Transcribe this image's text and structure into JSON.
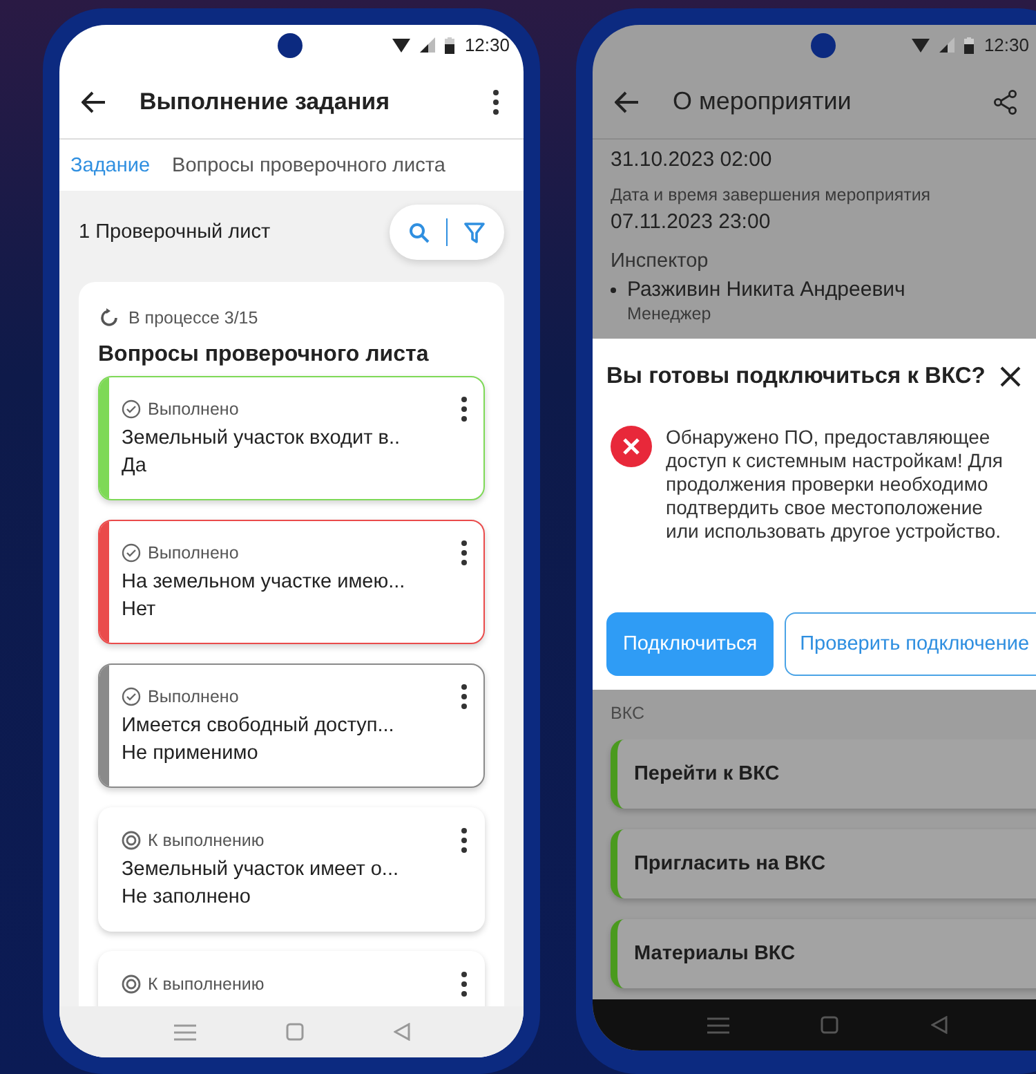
{
  "left_phone": {
    "status_bar": {
      "time": "12:30"
    },
    "app_bar": {
      "title": "Выполнение задания"
    },
    "tabs": [
      {
        "label": "Задание",
        "selected": true
      },
      {
        "label": "Вопросы проверочного листа",
        "selected": false
      }
    ],
    "checklist_count": "1 Проверочный лист",
    "checklist": {
      "progress": "В процессе 3/15",
      "title": "Вопросы проверочного листа",
      "questions": [
        {
          "kind": "done",
          "status": "Выполнено",
          "question": "Земельный участок входит в..",
          "answer": "Да",
          "color": "#7ed957"
        },
        {
          "kind": "done",
          "status": "Выполнено",
          "question": "На земельном участке имею...",
          "answer": "Нет",
          "color": "#ea4b4b"
        },
        {
          "kind": "done",
          "status": "Выполнено",
          "question": "Имеется свободный доступ...",
          "answer": "Не применимо",
          "color": "#8a8a8a"
        },
        {
          "kind": "todo",
          "status": "К выполнению",
          "question": "Земельный участок имеет о...",
          "answer": "Не заполнено"
        },
        {
          "kind": "todo",
          "status": "К выполнению"
        }
      ]
    }
  },
  "right_phone": {
    "status_bar": {
      "time": "12:30"
    },
    "app_bar": {
      "title": "О мероприятии"
    },
    "details": [
      {
        "kind": "value",
        "text": "31.10.2023 02:00"
      },
      {
        "kind": "label",
        "text": "Дата и время завершения мероприятия"
      },
      {
        "kind": "value",
        "text": "07.11.2023 23:00"
      },
      {
        "kind": "heading",
        "text": "Инспектор"
      },
      {
        "kind": "person",
        "text": "Разживин Никита Андреевич",
        "role": "Менеджер"
      }
    ],
    "dialog": {
      "title": "Вы готовы подключиться к ВКС?",
      "message": "Обнаружено ПО, предоставляющее доступ к системным настройкам! Для продолжения проверки необходимо подтвердить свое местоположение или использовать другое устройство.",
      "buttons": [
        {
          "label": "Подключиться",
          "kind": "primary"
        },
        {
          "label": "Проверить подключение",
          "kind": "outlined"
        }
      ]
    },
    "section_label": "ВКС",
    "actions": [
      "Перейти к ВКС",
      "Пригласить на ВКС",
      "Материалы ВКС"
    ]
  }
}
